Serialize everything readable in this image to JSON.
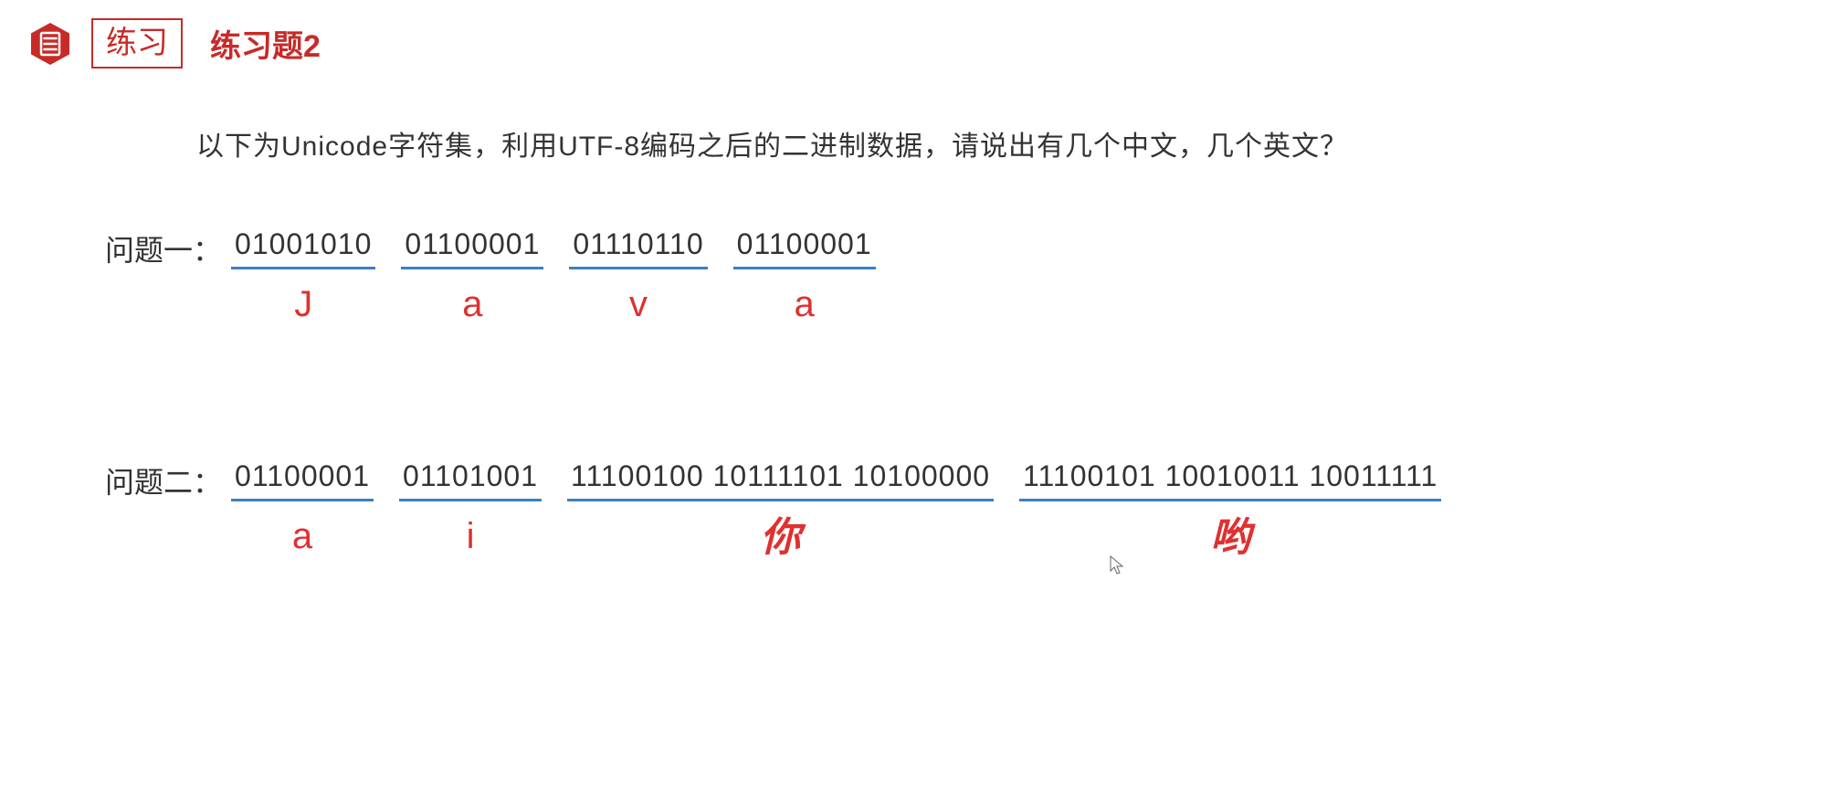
{
  "header": {
    "badge": "练习",
    "title": "练习题2"
  },
  "prompt": "以下为Unicode字符集，利用UTF-8编码之后的二进制数据，请说出有几个中文，几个英文？",
  "problems": [
    {
      "label": "问题一：",
      "groups": [
        {
          "binary": "01001010",
          "answer": "J",
          "cn": false
        },
        {
          "binary": "01100001",
          "answer": "a",
          "cn": false
        },
        {
          "binary": "01110110",
          "answer": "v",
          "cn": false
        },
        {
          "binary": "01100001",
          "answer": "a",
          "cn": false
        }
      ]
    },
    {
      "label": "问题二：",
      "groups": [
        {
          "binary": "01100001",
          "answer": "a",
          "cn": false
        },
        {
          "binary": "01101001",
          "answer": "i",
          "cn": false
        },
        {
          "binary": "11100100 10111101 10100000",
          "answer": "你",
          "cn": true
        },
        {
          "binary": "11100101 10010011 10011111",
          "answer": "哟",
          "cn": true
        }
      ]
    }
  ]
}
